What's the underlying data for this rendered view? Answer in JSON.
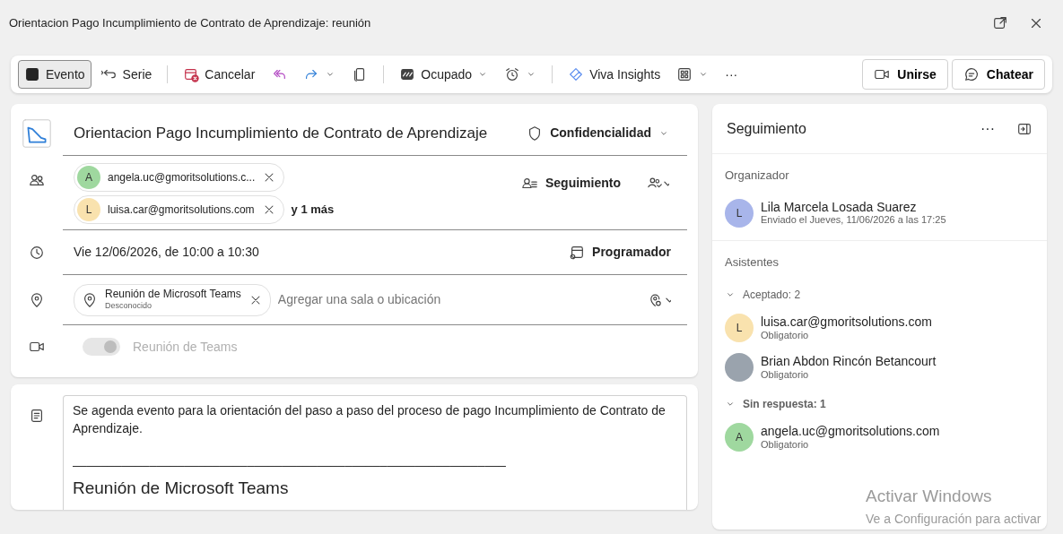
{
  "window": {
    "title": "Orientacion Pago Incumplimiento de Contrato de Aprendizaje: reunión"
  },
  "toolbar": {
    "groups": [
      [
        {
          "label": "Evento",
          "selected": true,
          "dropdown": false
        },
        {
          "label": "Serie",
          "selected": false,
          "dropdown": false
        }
      ],
      [
        {
          "label": "Cancelar",
          "selected": false,
          "dropdown": false
        },
        {
          "selected": false,
          "dropdown": false
        },
        {
          "selected": false,
          "dropdown": true
        },
        {
          "selected": false,
          "dropdown": false
        }
      ],
      [
        {
          "label": "Ocupado",
          "selected": false,
          "dropdown": true
        },
        {
          "selected": false,
          "dropdown": true
        }
      ],
      [
        {
          "label": "Viva Insights",
          "selected": false,
          "dropdown": false
        },
        {
          "selected": false,
          "dropdown": true
        },
        {
          "label": "···",
          "selected": false,
          "dropdown": false
        }
      ]
    ],
    "actions": [
      "Unirse",
      "Chatear"
    ]
  },
  "form": {
    "title": "Orientacion Pago Incumplimiento de Contrato de Aprendizaje",
    "sensitivity": "Confidencialidad",
    "attendees": [
      {
        "initial": "A",
        "email": "angela.uc@gmoritsolutions.c...",
        "color": "#9fd89f"
      },
      {
        "initial": "L",
        "email": "luisa.car@gmoritsolutions.com",
        "color": "#f9e2ae"
      }
    ],
    "more": "y 1 más",
    "tracking": "Seguimiento",
    "date": "Vie 12/06/2026, de 10:00 a 10:30",
    "scheduler": "Programador",
    "location": {
      "title": "Reunión de Microsoft Teams",
      "subtitle": "Desconocido",
      "placeholder": "Agregar una sala o ubicación"
    },
    "teams": {
      "label": "Reunión de Teams",
      "on": true,
      "disabled": true
    }
  },
  "body": {
    "paragraph": "Se agenda evento para la orientación del paso a paso del proceso de pago Incumplimiento de Contrato de Aprendizaje.",
    "rule": "______________________________________________________________",
    "heading": "Reunión de Microsoft Teams"
  },
  "panel": {
    "title": "Seguimiento",
    "more": "···",
    "organizer_heading": "Organizador",
    "organizer": {
      "initial": "L",
      "name": "Lila Marcela Losada Suarez",
      "detail": "Enviado el Jueves, 11/06/2026 a las 17:25",
      "color": "#a8b5ea"
    },
    "attendees_heading": "Asistentes",
    "groups": [
      {
        "label": "Aceptado: 2",
        "expanded": true,
        "people": [
          {
            "kind": "initial",
            "initial": "L",
            "name": "luisa.car@gmoritsolutions.com",
            "role": "Obligatorio",
            "color": "#f9e2ae"
          },
          {
            "kind": "photo",
            "name": "Brian Abdon Rincón Betancourt",
            "role": "Obligatorio"
          }
        ]
      },
      {
        "label": "Sin respuesta: 1",
        "expanded": true,
        "people": [
          {
            "kind": "initial",
            "initial": "A",
            "name": "angela.uc@gmoritsolutions.com",
            "role": "Obligatorio",
            "color": "#9fd89f"
          }
        ]
      }
    ]
  },
  "os_notice": {
    "title": "Activar Windows",
    "text": "Ve a Configuración para activar"
  }
}
